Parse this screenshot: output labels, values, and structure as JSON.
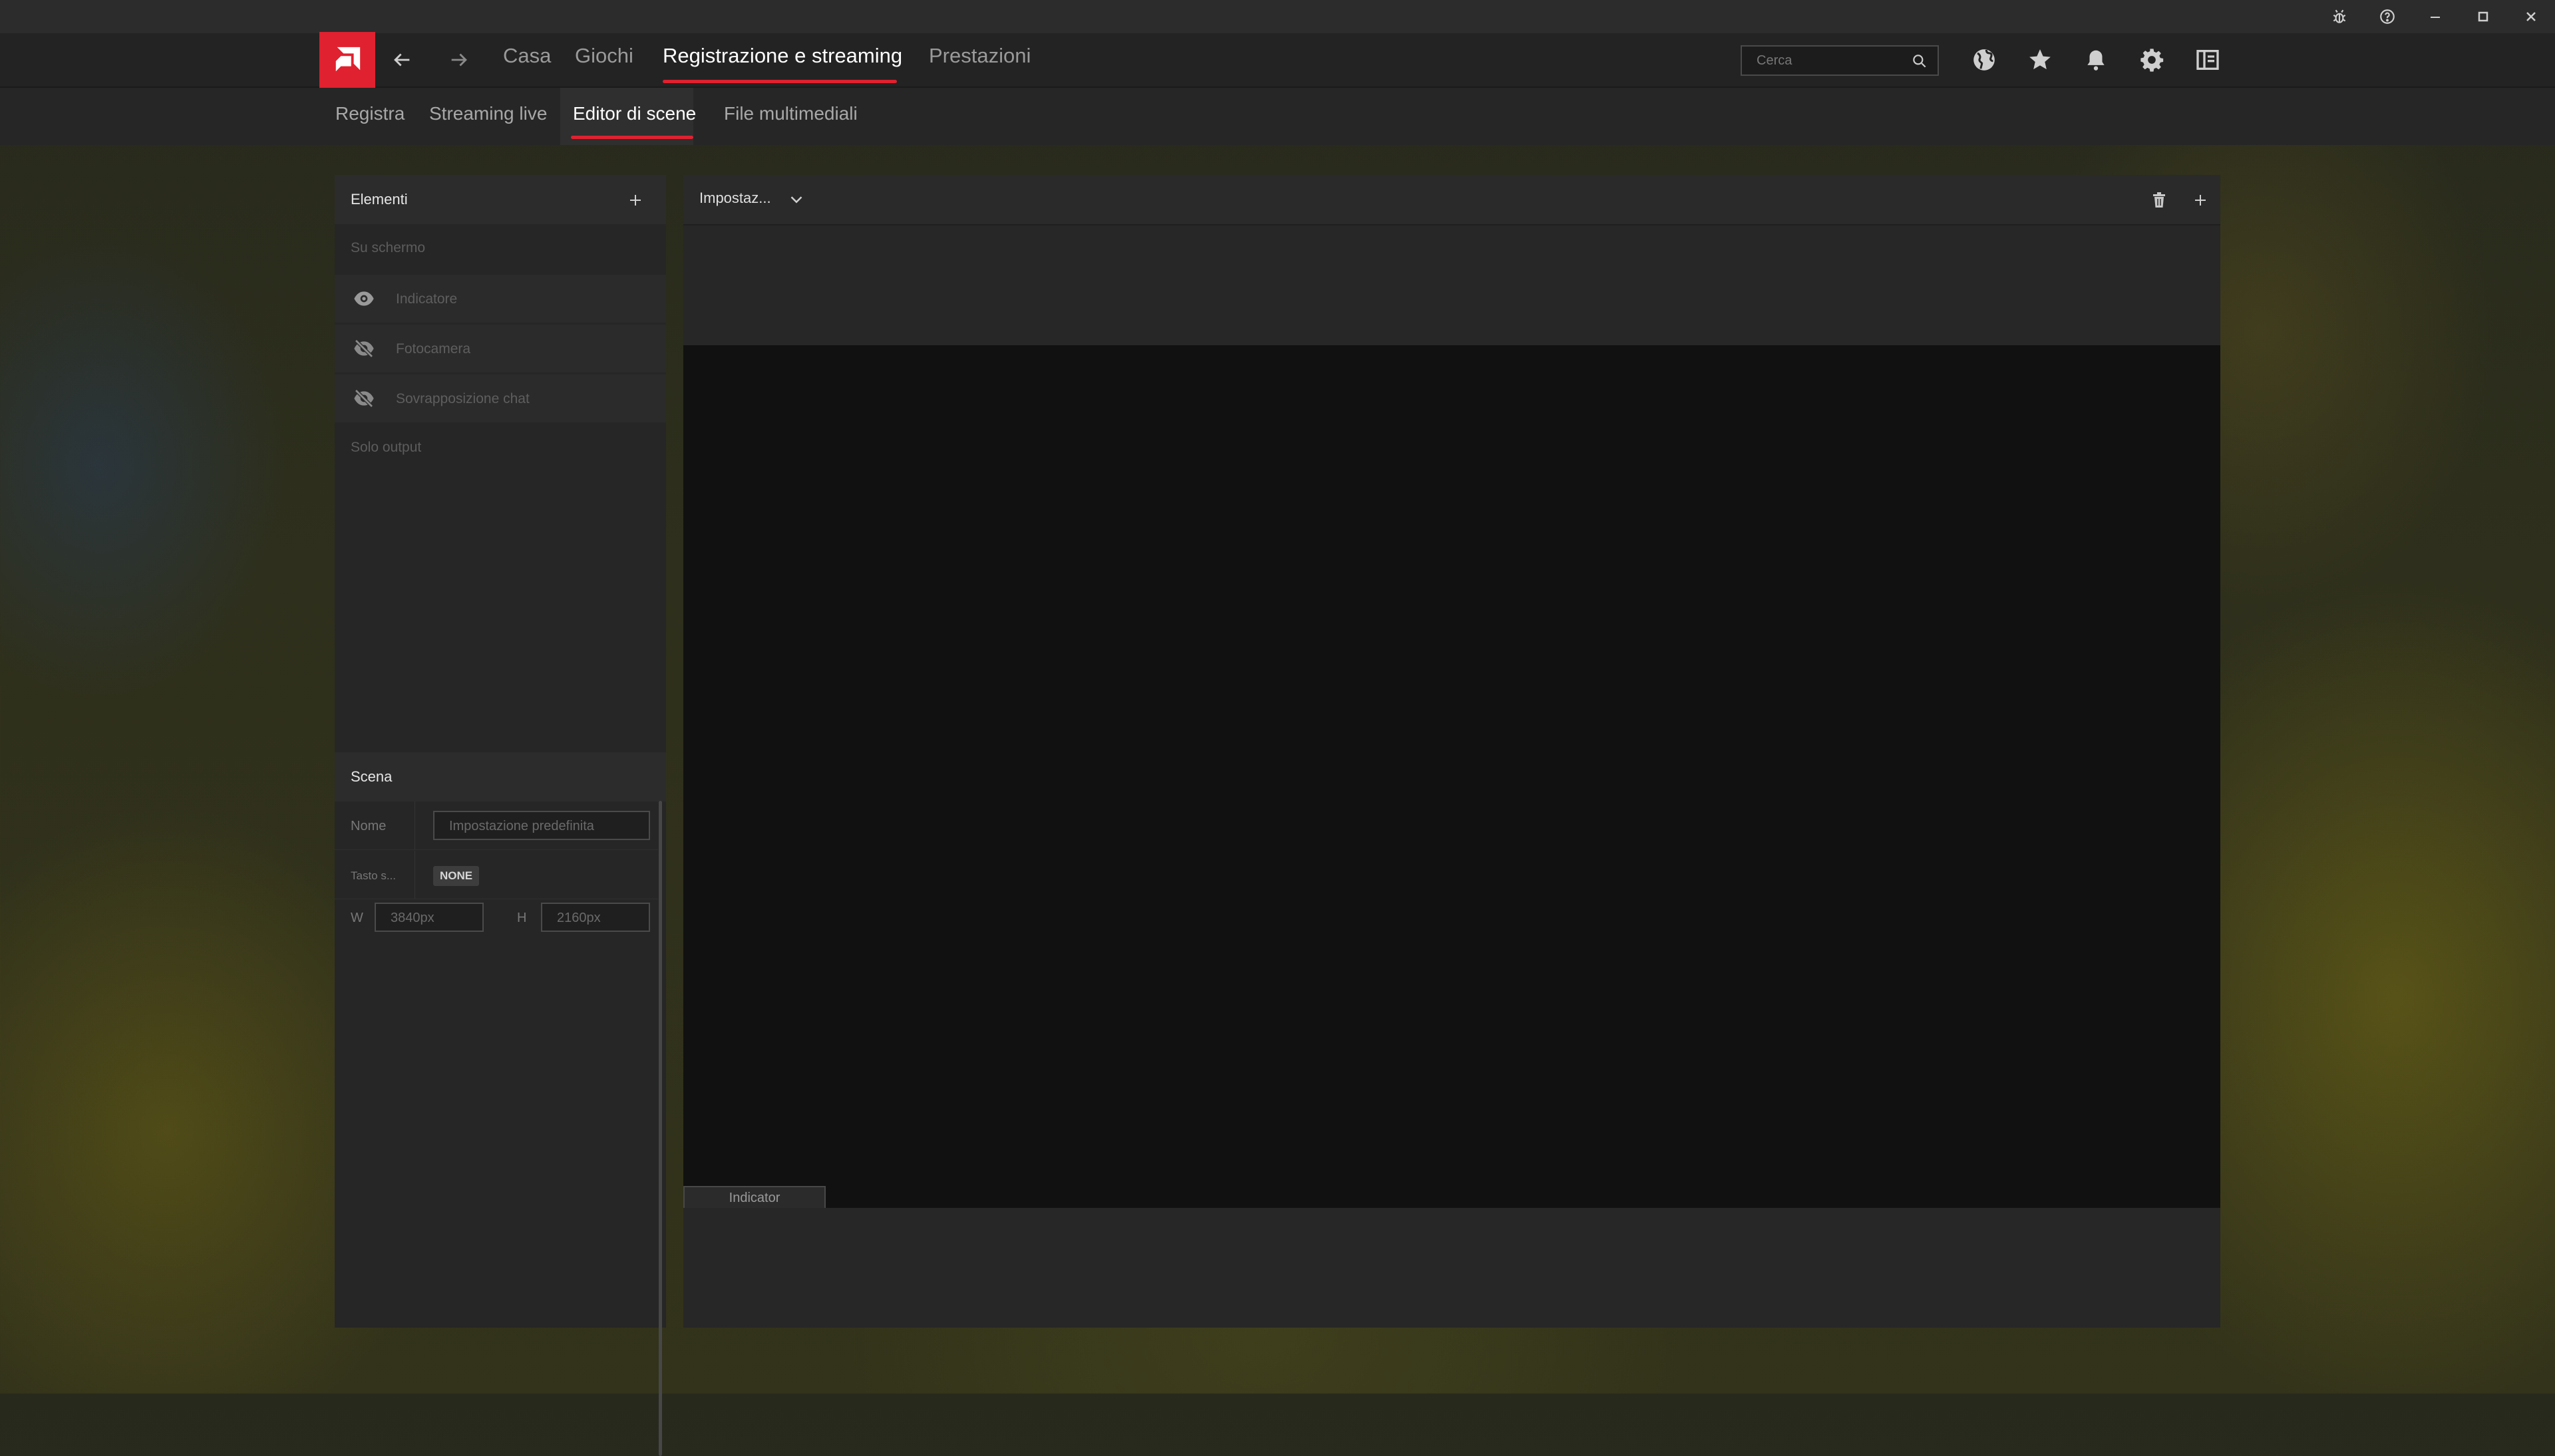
{
  "colors": {
    "accent": "#e0212f",
    "panel": "#262626",
    "canvas": "#111111"
  },
  "window_controls": [
    {
      "icon": "bug-icon"
    },
    {
      "icon": "help-icon"
    },
    {
      "icon": "minimize-icon"
    },
    {
      "icon": "maximize-icon"
    },
    {
      "icon": "close-icon"
    }
  ],
  "nav": {
    "back_icon": "arrow-left-icon",
    "forward_icon": "arrow-right-icon",
    "tabs": [
      {
        "label": "Casa"
      },
      {
        "label": "Giochi"
      },
      {
        "label": "Registrazione e streaming",
        "active": true
      },
      {
        "label": "Prestazioni"
      }
    ],
    "search_placeholder": "Cerca",
    "right_icons": [
      "globe-icon",
      "star-icon",
      "bell-icon",
      "gear-icon",
      "panel-icon"
    ]
  },
  "subnav": {
    "tabs": [
      {
        "label": "Registra"
      },
      {
        "label": "Streaming live"
      },
      {
        "label": "Editor di scene",
        "active": true
      },
      {
        "label": "File multimediali"
      }
    ]
  },
  "elements_panel": {
    "title": "Elementi",
    "on_screen_label": "Su schermo",
    "items": [
      {
        "label": "Indicatore",
        "icon": "eye-icon"
      },
      {
        "label": "Fotocamera",
        "icon": "eye-off-icon"
      },
      {
        "label": "Sovrapposizione chat",
        "icon": "eye-off-icon"
      }
    ],
    "output_only_label": "Solo output"
  },
  "scene_panel": {
    "title": "Scena",
    "name_label": "Nome",
    "name_value": "Impostazione predefinita",
    "hotkey_label": "Tasto s...",
    "hotkey_value": "NONE",
    "width_label": "W",
    "width_value": "3840px",
    "height_label": "H",
    "height_value": "2160px"
  },
  "main_panel": {
    "scene_select": "Impostaz...",
    "canvas_indicator": "Indicator"
  }
}
